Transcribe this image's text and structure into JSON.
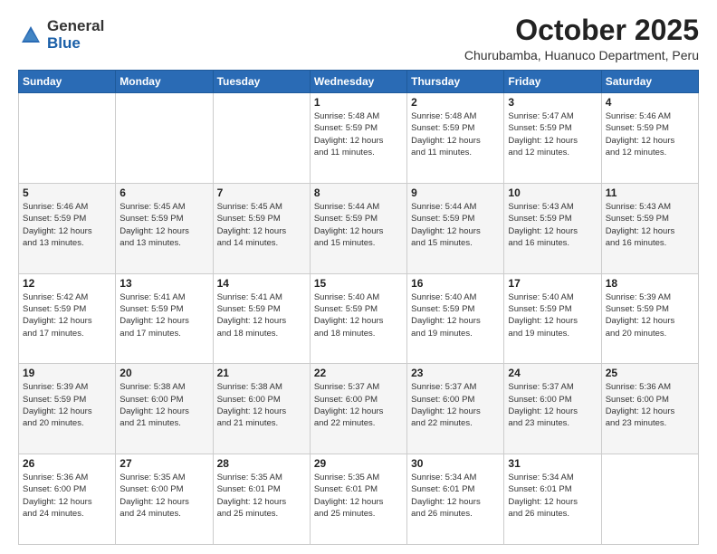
{
  "logo": {
    "general": "General",
    "blue": "Blue"
  },
  "title": "October 2025",
  "subtitle": "Churubamba, Huanuco Department, Peru",
  "days_of_week": [
    "Sunday",
    "Monday",
    "Tuesday",
    "Wednesday",
    "Thursday",
    "Friday",
    "Saturday"
  ],
  "weeks": [
    [
      {
        "day": "",
        "info": ""
      },
      {
        "day": "",
        "info": ""
      },
      {
        "day": "",
        "info": ""
      },
      {
        "day": "1",
        "info": "Sunrise: 5:48 AM\nSunset: 5:59 PM\nDaylight: 12 hours\nand 11 minutes."
      },
      {
        "day": "2",
        "info": "Sunrise: 5:48 AM\nSunset: 5:59 PM\nDaylight: 12 hours\nand 11 minutes."
      },
      {
        "day": "3",
        "info": "Sunrise: 5:47 AM\nSunset: 5:59 PM\nDaylight: 12 hours\nand 12 minutes."
      },
      {
        "day": "4",
        "info": "Sunrise: 5:46 AM\nSunset: 5:59 PM\nDaylight: 12 hours\nand 12 minutes."
      }
    ],
    [
      {
        "day": "5",
        "info": "Sunrise: 5:46 AM\nSunset: 5:59 PM\nDaylight: 12 hours\nand 13 minutes."
      },
      {
        "day": "6",
        "info": "Sunrise: 5:45 AM\nSunset: 5:59 PM\nDaylight: 12 hours\nand 13 minutes."
      },
      {
        "day": "7",
        "info": "Sunrise: 5:45 AM\nSunset: 5:59 PM\nDaylight: 12 hours\nand 14 minutes."
      },
      {
        "day": "8",
        "info": "Sunrise: 5:44 AM\nSunset: 5:59 PM\nDaylight: 12 hours\nand 15 minutes."
      },
      {
        "day": "9",
        "info": "Sunrise: 5:44 AM\nSunset: 5:59 PM\nDaylight: 12 hours\nand 15 minutes."
      },
      {
        "day": "10",
        "info": "Sunrise: 5:43 AM\nSunset: 5:59 PM\nDaylight: 12 hours\nand 16 minutes."
      },
      {
        "day": "11",
        "info": "Sunrise: 5:43 AM\nSunset: 5:59 PM\nDaylight: 12 hours\nand 16 minutes."
      }
    ],
    [
      {
        "day": "12",
        "info": "Sunrise: 5:42 AM\nSunset: 5:59 PM\nDaylight: 12 hours\nand 17 minutes."
      },
      {
        "day": "13",
        "info": "Sunrise: 5:41 AM\nSunset: 5:59 PM\nDaylight: 12 hours\nand 17 minutes."
      },
      {
        "day": "14",
        "info": "Sunrise: 5:41 AM\nSunset: 5:59 PM\nDaylight: 12 hours\nand 18 minutes."
      },
      {
        "day": "15",
        "info": "Sunrise: 5:40 AM\nSunset: 5:59 PM\nDaylight: 12 hours\nand 18 minutes."
      },
      {
        "day": "16",
        "info": "Sunrise: 5:40 AM\nSunset: 5:59 PM\nDaylight: 12 hours\nand 19 minutes."
      },
      {
        "day": "17",
        "info": "Sunrise: 5:40 AM\nSunset: 5:59 PM\nDaylight: 12 hours\nand 19 minutes."
      },
      {
        "day": "18",
        "info": "Sunrise: 5:39 AM\nSunset: 5:59 PM\nDaylight: 12 hours\nand 20 minutes."
      }
    ],
    [
      {
        "day": "19",
        "info": "Sunrise: 5:39 AM\nSunset: 5:59 PM\nDaylight: 12 hours\nand 20 minutes."
      },
      {
        "day": "20",
        "info": "Sunrise: 5:38 AM\nSunset: 6:00 PM\nDaylight: 12 hours\nand 21 minutes."
      },
      {
        "day": "21",
        "info": "Sunrise: 5:38 AM\nSunset: 6:00 PM\nDaylight: 12 hours\nand 21 minutes."
      },
      {
        "day": "22",
        "info": "Sunrise: 5:37 AM\nSunset: 6:00 PM\nDaylight: 12 hours\nand 22 minutes."
      },
      {
        "day": "23",
        "info": "Sunrise: 5:37 AM\nSunset: 6:00 PM\nDaylight: 12 hours\nand 22 minutes."
      },
      {
        "day": "24",
        "info": "Sunrise: 5:37 AM\nSunset: 6:00 PM\nDaylight: 12 hours\nand 23 minutes."
      },
      {
        "day": "25",
        "info": "Sunrise: 5:36 AM\nSunset: 6:00 PM\nDaylight: 12 hours\nand 23 minutes."
      }
    ],
    [
      {
        "day": "26",
        "info": "Sunrise: 5:36 AM\nSunset: 6:00 PM\nDaylight: 12 hours\nand 24 minutes."
      },
      {
        "day": "27",
        "info": "Sunrise: 5:35 AM\nSunset: 6:00 PM\nDaylight: 12 hours\nand 24 minutes."
      },
      {
        "day": "28",
        "info": "Sunrise: 5:35 AM\nSunset: 6:01 PM\nDaylight: 12 hours\nand 25 minutes."
      },
      {
        "day": "29",
        "info": "Sunrise: 5:35 AM\nSunset: 6:01 PM\nDaylight: 12 hours\nand 25 minutes."
      },
      {
        "day": "30",
        "info": "Sunrise: 5:34 AM\nSunset: 6:01 PM\nDaylight: 12 hours\nand 26 minutes."
      },
      {
        "day": "31",
        "info": "Sunrise: 5:34 AM\nSunset: 6:01 PM\nDaylight: 12 hours\nand 26 minutes."
      },
      {
        "day": "",
        "info": ""
      }
    ]
  ]
}
